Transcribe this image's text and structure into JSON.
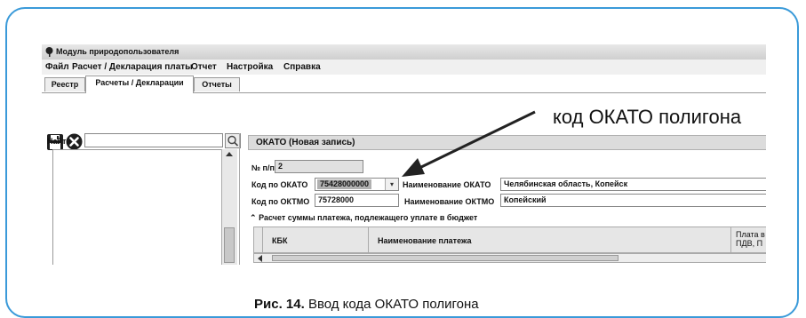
{
  "window": {
    "title": "Модуль природопользователя"
  },
  "menu": [
    "Файл",
    "Расчет / Декларация платы",
    "Отчет",
    "Настройка",
    "Справка"
  ],
  "tabs": [
    "Реестр",
    "Расчеты / Декларации",
    "Отчеты"
  ],
  "search": {
    "label": "Найти",
    "value": ""
  },
  "form": {
    "header": "ОКАТО (Новая запись)",
    "num_label": "№ п/п",
    "num_value": "2",
    "okato_code_label": "Код по ОКАТО",
    "okato_code_value": "75428000000",
    "okato_name_label": "Наименование ОКАТО",
    "okato_name_value": "Челябинская область, Копейск",
    "oktmo_code_label": "Код по ОКТМО",
    "oktmo_code_value": "75728000",
    "oktmo_name_label": "Наименование ОКТМО",
    "oktmo_name_value": "Копейский"
  },
  "payment_section": {
    "title": "Расчет суммы платежа, подлежащего уплате в бюджет",
    "columns": [
      "КБК",
      "Наименование платежа",
      "Плата в",
      "ПДВ, П"
    ]
  },
  "annotation": "код ОКАТО полигона",
  "caption": {
    "prefix": "Рис. 14.",
    "text": "Ввод кода ОКАТО полигона"
  },
  "colors": {
    "frame": "#3a9ad9",
    "accent_dark": "#222222"
  },
  "icons": {
    "save": "floppy-disk-icon",
    "cancel": "close-circle-icon",
    "search": "search-icon",
    "dropdown": "chevron-down-icon"
  }
}
